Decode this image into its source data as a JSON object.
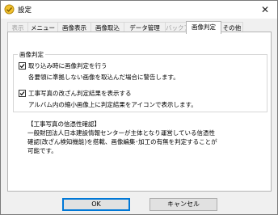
{
  "window": {
    "title": "設定",
    "close_glyph": "✕"
  },
  "tabs": [
    {
      "label": "表示",
      "state": "disabled"
    },
    {
      "label": "メニュー",
      "state": "normal"
    },
    {
      "label": "画像表示",
      "state": "normal"
    },
    {
      "label": "画像取込",
      "state": "normal"
    },
    {
      "label": "データ管理",
      "state": "normal"
    },
    {
      "label": "バックアップ",
      "state": "disabled"
    },
    {
      "label": "画像判定",
      "state": "active"
    },
    {
      "label": "その他",
      "state": "normal"
    }
  ],
  "group": {
    "label": "画像判定",
    "option1": {
      "label": "取り込み時に画像判定を行う",
      "checked": true,
      "description": "各要領に準拠しない画像を取込んだ場合に警告します。"
    },
    "option2": {
      "label": "工事写真の改ざん判定結果を表示する",
      "checked": true,
      "description": "アルバム内の縮小画像上に判定結果をアイコンで表示します。"
    }
  },
  "info": {
    "heading": "【工事写真の信憑性確認】",
    "line1": "一般財団法人日本建設情報センターが主体となり運営している信憑性",
    "line2": "確認(改ざん検知機能)を搭載、画像編集･加工の有無を判定することが",
    "line3": "可能です。"
  },
  "buttons": {
    "ok": "OK",
    "cancel": "キャンセル"
  },
  "colors": {
    "accent": "#0078d7",
    "icon_yellow": "#f2c12e"
  },
  "icons": {
    "app": "settings-app-icon",
    "close": "close-icon",
    "check": "checkmark-icon"
  }
}
